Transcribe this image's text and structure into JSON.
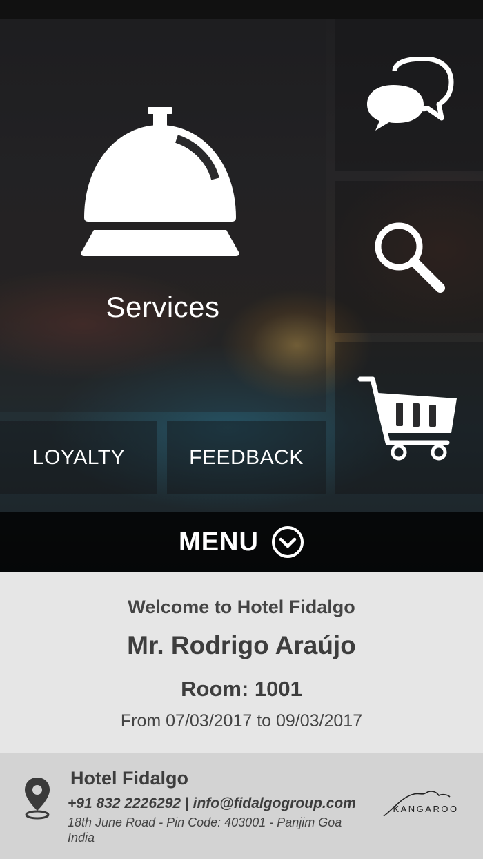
{
  "tiles": {
    "services_label": "Services",
    "loyalty_label": "LOYALTY",
    "feedback_label": "FEEDBACK"
  },
  "icons": {
    "services": "bell-icon",
    "chat": "chat-bubbles-icon",
    "search": "search-icon",
    "cart": "shopping-cart-icon",
    "menu_toggle": "chevron-down-circle-icon",
    "location": "location-pin-icon"
  },
  "menu": {
    "label": "MENU"
  },
  "welcome": {
    "greeting": "Welcome to Hotel Fidalgo",
    "guest_name": "Mr. Rodrigo Araújo",
    "room": "Room: 1001",
    "stay_dates": "From 07/03/2017 to 09/03/2017"
  },
  "footer": {
    "hotel_name": "Hotel Fidalgo",
    "contact": "+91 832 2226292 | info@fidalgogroup.com",
    "address": "18th June Road  - Pin Code: 403001 - Panjim Goa India",
    "brand": "KANGAROO"
  },
  "colors": {
    "welcome_bg": "#e6e6e6",
    "footer_bg": "#d3d3d3",
    "text_dark": "#3d3d3d"
  }
}
